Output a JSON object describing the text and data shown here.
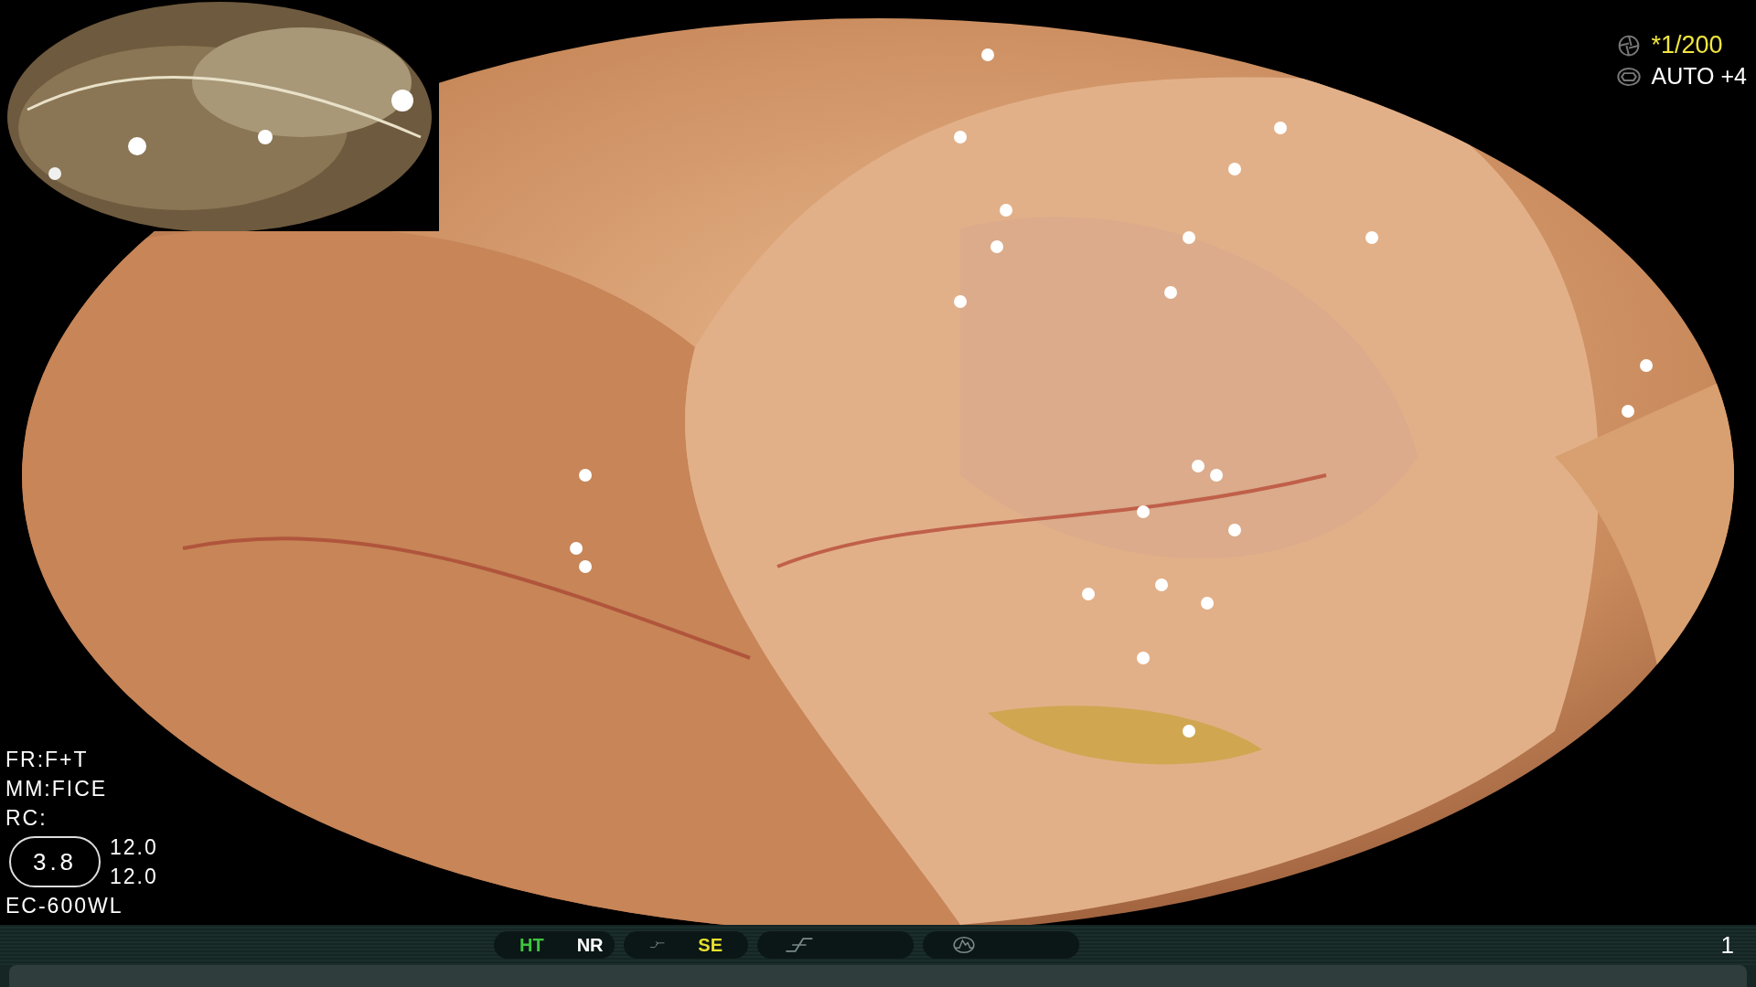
{
  "exposure": {
    "shutter": "*1/200",
    "iris": "AUTO +4"
  },
  "settings": [
    {
      "label": "FR:F+T"
    },
    {
      "label": "MM:FICE"
    },
    {
      "label": "RC:"
    }
  ],
  "zoom": {
    "value": "3.8",
    "readings": [
      "12.0",
      "12.0"
    ]
  },
  "scope_model": "EC-600WL",
  "status_bar": {
    "groups": [
      {
        "kind": "text",
        "items": [
          {
            "label": "HT",
            "color": "#3fc43f"
          },
          {
            "label": "NR",
            "color": "#ffffff"
          }
        ]
      },
      {
        "kind": "curve",
        "items": [
          {
            "label": "SE",
            "color": "#e8df2e"
          }
        ]
      },
      {
        "kind": "edge"
      },
      {
        "kind": "peak"
      }
    ],
    "page": "1"
  }
}
